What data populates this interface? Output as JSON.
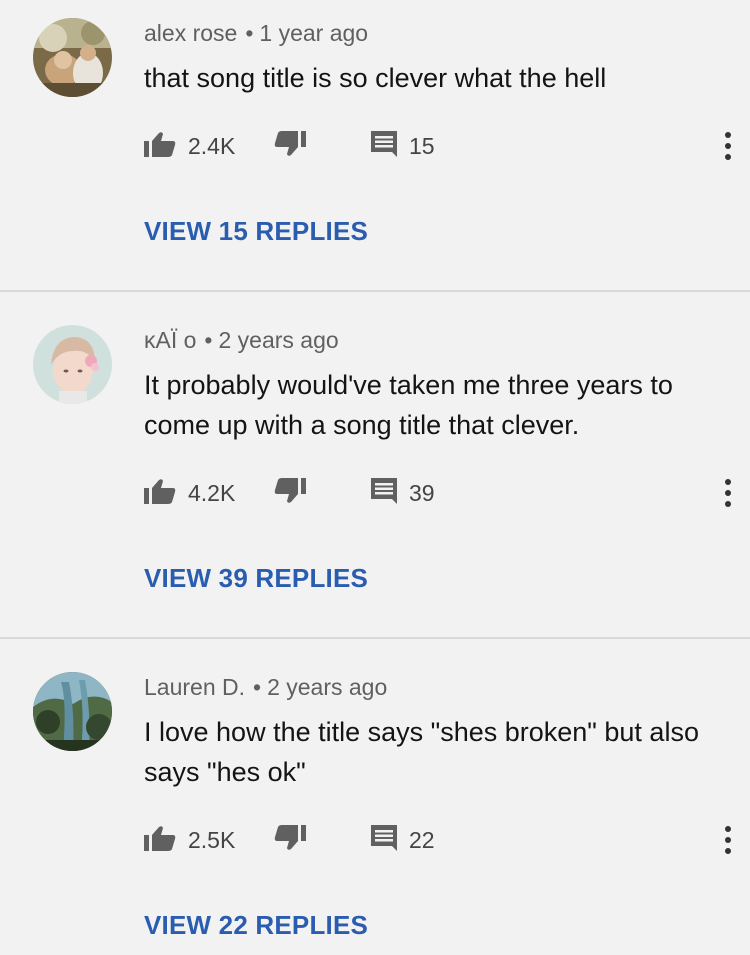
{
  "comments": [
    {
      "author": "alex rose",
      "time": "1 year ago",
      "text": "that song title is so clever what the hell",
      "likes": "2.4K",
      "reply_count": "15",
      "view_replies": "VIEW 15 REPLIES",
      "avatar_icon": "avatar-photo-dog"
    },
    {
      "author": "κAÏ o",
      "time": "2 years ago",
      "text": "It probably would've taken me three years to come up with a song title that clever.",
      "likes": "4.2K",
      "reply_count": "39",
      "view_replies": "VIEW 39 REPLIES",
      "avatar_icon": "avatar-photo-person"
    },
    {
      "author": "Lauren D.",
      "time": "2 years ago",
      "text": "I love how the title says \"shes broken\" but also says \"hes ok\"",
      "likes": "2.5K",
      "reply_count": "22",
      "view_replies": "VIEW 22 REPLIES",
      "avatar_icon": "avatar-photo-forest"
    }
  ],
  "separator": "•",
  "colors": {
    "background": "#f2f2f2",
    "link": "#2a5db0",
    "meta": "#606060",
    "icon": "#606060"
  }
}
